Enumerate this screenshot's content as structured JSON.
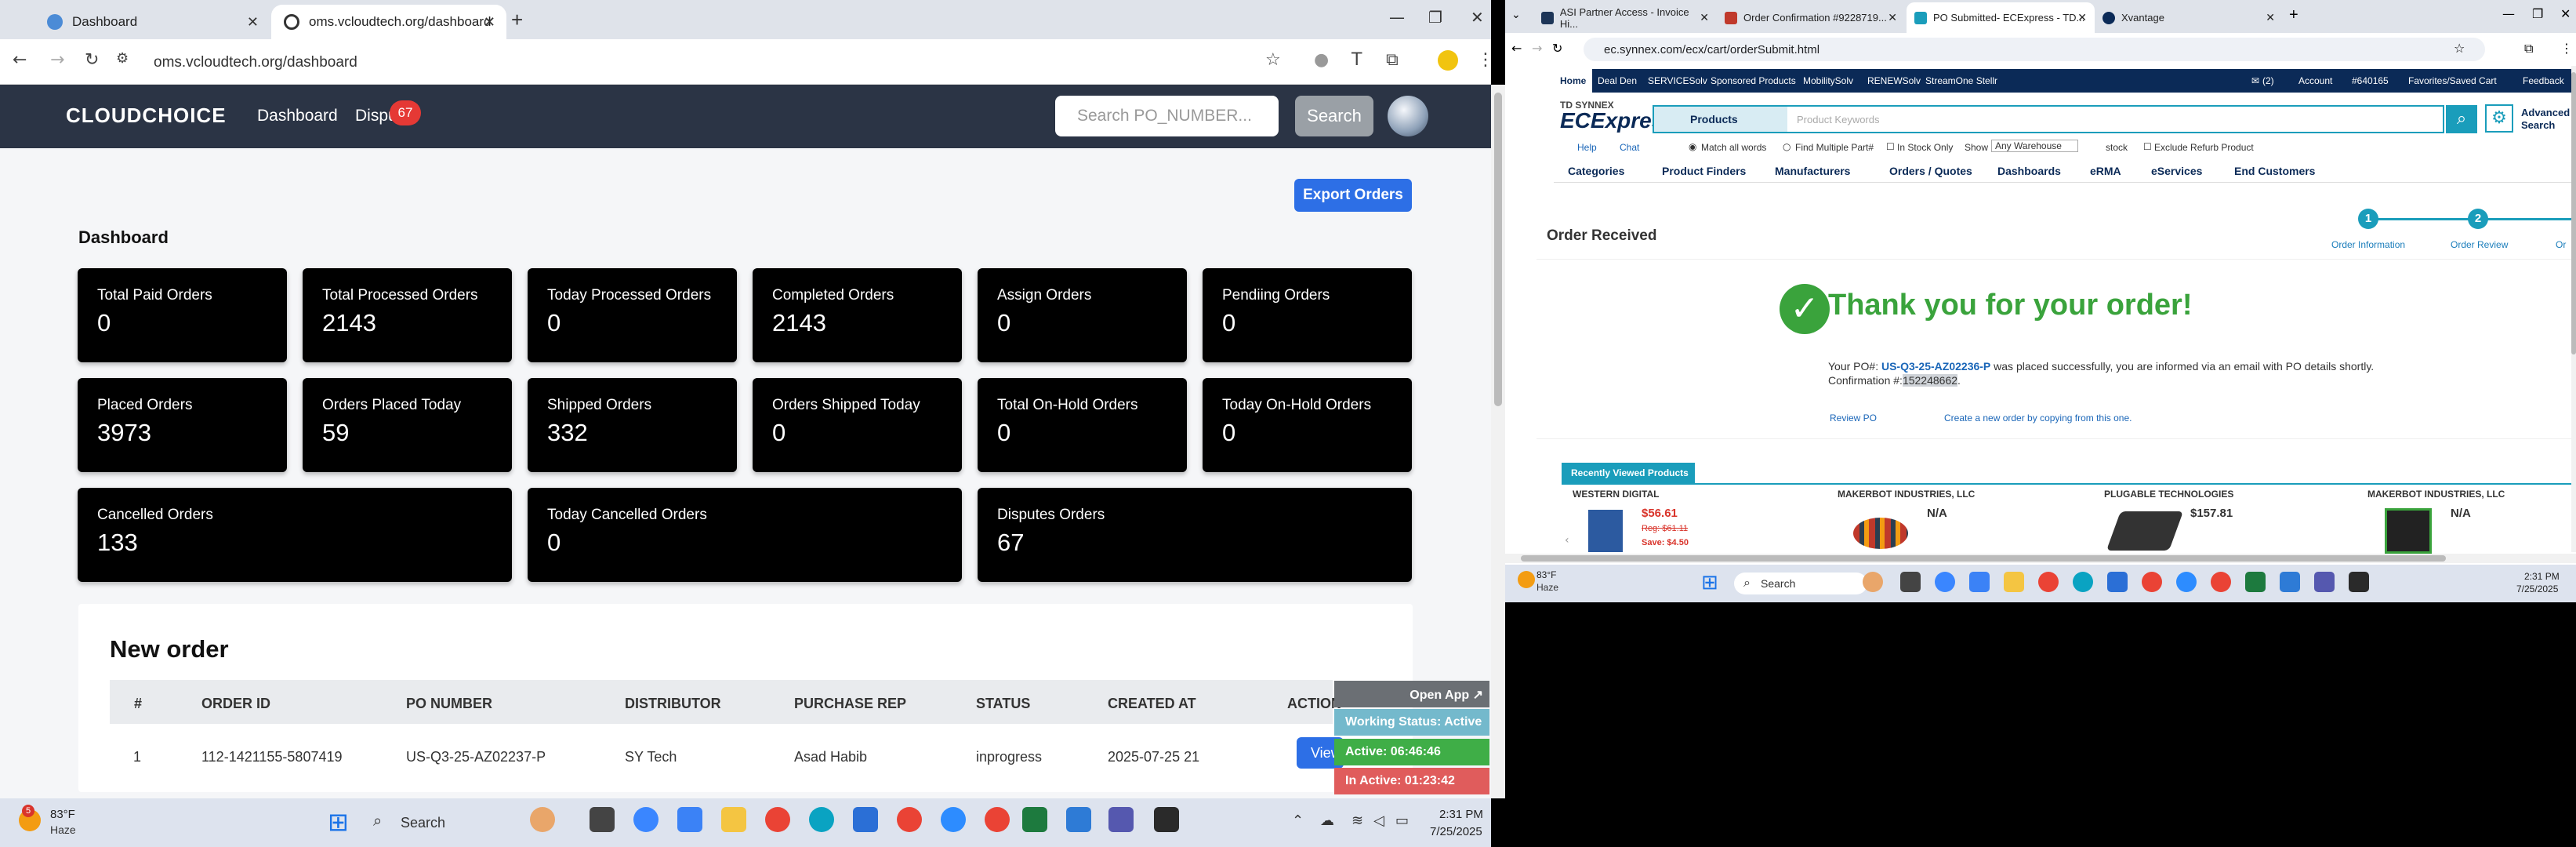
{
  "left_browser": {
    "tabs": [
      {
        "title": "Dashboard",
        "active": false
      },
      {
        "title": "oms.vcloudtech.org/dashboard",
        "active": true
      }
    ],
    "url": "oms.vcloudtech.org/dashboard",
    "new_tab": "+"
  },
  "app": {
    "logo": "CLOUDCHOICE",
    "nav": {
      "dashboard": "Dashboard",
      "disputes": "Dispu",
      "disputes_badge": "67"
    },
    "search_placeholder": "Search PO_NUMBER...",
    "search_button": "Search",
    "export_button": "Export Orders",
    "title": "Dashboard",
    "stats": [
      {
        "label": "Total Paid Orders",
        "value": "0"
      },
      {
        "label": "Total Processed Orders",
        "value": "2143"
      },
      {
        "label": "Today Processed Orders",
        "value": "0"
      },
      {
        "label": "Completed Orders",
        "value": "2143"
      },
      {
        "label": "Assign Orders",
        "value": "0"
      },
      {
        "label": "Pendiing Orders",
        "value": "0"
      },
      {
        "label": "Placed Orders",
        "value": "3973"
      },
      {
        "label": "Orders Placed Today",
        "value": "59"
      },
      {
        "label": "Shipped Orders",
        "value": "332"
      },
      {
        "label": "Orders Shipped Today",
        "value": "0"
      },
      {
        "label": "Total On-Hold Orders",
        "value": "0"
      },
      {
        "label": "Today On-Hold Orders",
        "value": "0"
      },
      {
        "label": "Cancelled Orders",
        "value": "133"
      },
      {
        "label": "Today Cancelled Orders",
        "value": "0"
      },
      {
        "label": "Disputes Orders",
        "value": "67"
      }
    ],
    "new_order": {
      "title": "New order",
      "columns": [
        "#",
        "ORDER ID",
        "PO NUMBER",
        "DISTRIBUTOR",
        "PURCHASE REP",
        "STATUS",
        "CREATED AT",
        "ACTION"
      ],
      "rows": [
        {
          "num": "1",
          "order_id": "112-1421155-5807419",
          "po": "US-Q3-25-AZ02237-P",
          "distributor": "SY Tech",
          "rep": "Asad Habib",
          "status": "inprogress",
          "created": "2025-07-25 21",
          "action": "View"
        }
      ]
    }
  },
  "widget": {
    "open_app": "Open App ↗",
    "working_status": "Working Status: Active",
    "active": "Active: 06:46:46",
    "in_active": "In Active: 01:23:42"
  },
  "taskbar_left": {
    "weather_temp": "83°F",
    "weather_desc": "Haze",
    "weather_badge": "5",
    "search": "Search",
    "time": "2:31 PM",
    "date": "7/25/2025"
  },
  "right_browser": {
    "tabs": [
      {
        "title": "ASI Partner Access - Invoice Hi..."
      },
      {
        "title": "Order Confirmation #9228719..."
      },
      {
        "title": "PO Submitted- ECExpress - TD..."
      },
      {
        "title": "Xvantage"
      }
    ],
    "url": "ec.synnex.com/ecx/cart/orderSubmit.html"
  },
  "ecx": {
    "topnav": [
      "Home",
      "Deal Den",
      "SERVICESolv",
      "Sponsored Products",
      "MobilitySolv",
      "RENEWSolv",
      "StreamOne Stellr"
    ],
    "topnav_right": {
      "account": "Account",
      "acct_num": "#640165",
      "favorites": "Favorites/Saved Cart",
      "feedback": "Feedback",
      "msg_count": "(2)"
    },
    "logo_top": "TD SYNNEX",
    "logo_main": "ECExpress",
    "logo_e": "E",
    "search_category": "Products",
    "search_placeholder": "Product Keywords",
    "advanced": "Advanced",
    "advanced2": "Search",
    "help": "Help",
    "chat": "Chat",
    "match_all": "Match all words",
    "find_multiple": "Find Multiple Part#",
    "in_stock": "In Stock Only",
    "show": "Show",
    "warehouse": "Any Warehouse",
    "stock": "stock",
    "exclude": "Exclude Refurb Product",
    "categories": [
      "Categories",
      "Product Finders",
      "Manufacturers",
      "Orders / Quotes",
      "Dashboards",
      "eRMA",
      "eServices",
      "End Customers"
    ],
    "order_received": "Order Received",
    "steps": [
      {
        "n": "1",
        "label": "Order Information"
      },
      {
        "n": "2",
        "label": "Order Review"
      },
      {
        "label": "Or"
      }
    ],
    "thanks": "Thank you for your order!",
    "msg_pre": "Your PO#: ",
    "po": "US-Q3-25-AZ02236-P",
    "msg_mid": " was placed successfully, you are informed via an email with PO details shortly. Confirmation #:",
    "confirmation": "152248662",
    "msg_end": ".",
    "review_po": "Review PO",
    "new_order_link": "Create a new order by copying from this one.",
    "recently_viewed": "Recently Viewed Products",
    "products": [
      {
        "manufacturer": "WESTERN DIGITAL",
        "price": "$56.61",
        "reg": "Reg: $61.11",
        "save": "Save: $4.50"
      },
      {
        "manufacturer": "MAKERBOT INDUSTRIES, LLC",
        "price": "N/A"
      },
      {
        "manufacturer": "PLUGABLE TECHNOLOGIES",
        "price": "$157.81"
      },
      {
        "manufacturer": "MAKERBOT INDUSTRIES, LLC",
        "price": "N/A"
      }
    ]
  },
  "taskbar_right": {
    "weather_temp": "83°F",
    "weather_desc": "Haze",
    "search": "Search",
    "time": "2:31 PM",
    "date": "7/25/2025"
  }
}
